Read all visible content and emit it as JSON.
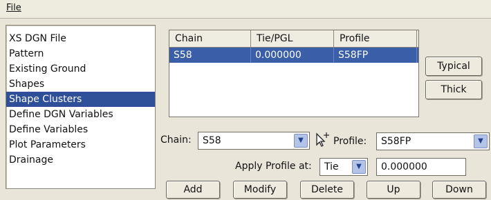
{
  "menu": {
    "file": "File"
  },
  "categories": [
    "XS DGN File",
    "Pattern",
    "Existing Ground",
    "Shapes",
    "Shape Clusters",
    "Define DGN Variables",
    "Define Variables",
    "Plot Parameters",
    "Drainage"
  ],
  "selected_category": "Shape Clusters",
  "table": {
    "headers": [
      "Chain",
      "Tie/PGL",
      "Profile"
    ],
    "rows": [
      [
        "S58",
        "0.000000",
        "S58FP"
      ]
    ]
  },
  "side_buttons": {
    "typical": "Typical",
    "thick": "Thick"
  },
  "form": {
    "chain_label": "Chain:",
    "chain_value": "S58",
    "profile_label": "Profile:",
    "profile_value": "S58FP",
    "apply_label": "Apply Profile at:",
    "apply_value": "Tie",
    "offset_value": "0.000000"
  },
  "buttons": {
    "add": "Add",
    "modify": "Modify",
    "delete": "Delete",
    "up": "Up",
    "down": "Down"
  },
  "icons": {
    "dropdown": "chevron-down-icon",
    "pick": "target-cursor-icon"
  }
}
